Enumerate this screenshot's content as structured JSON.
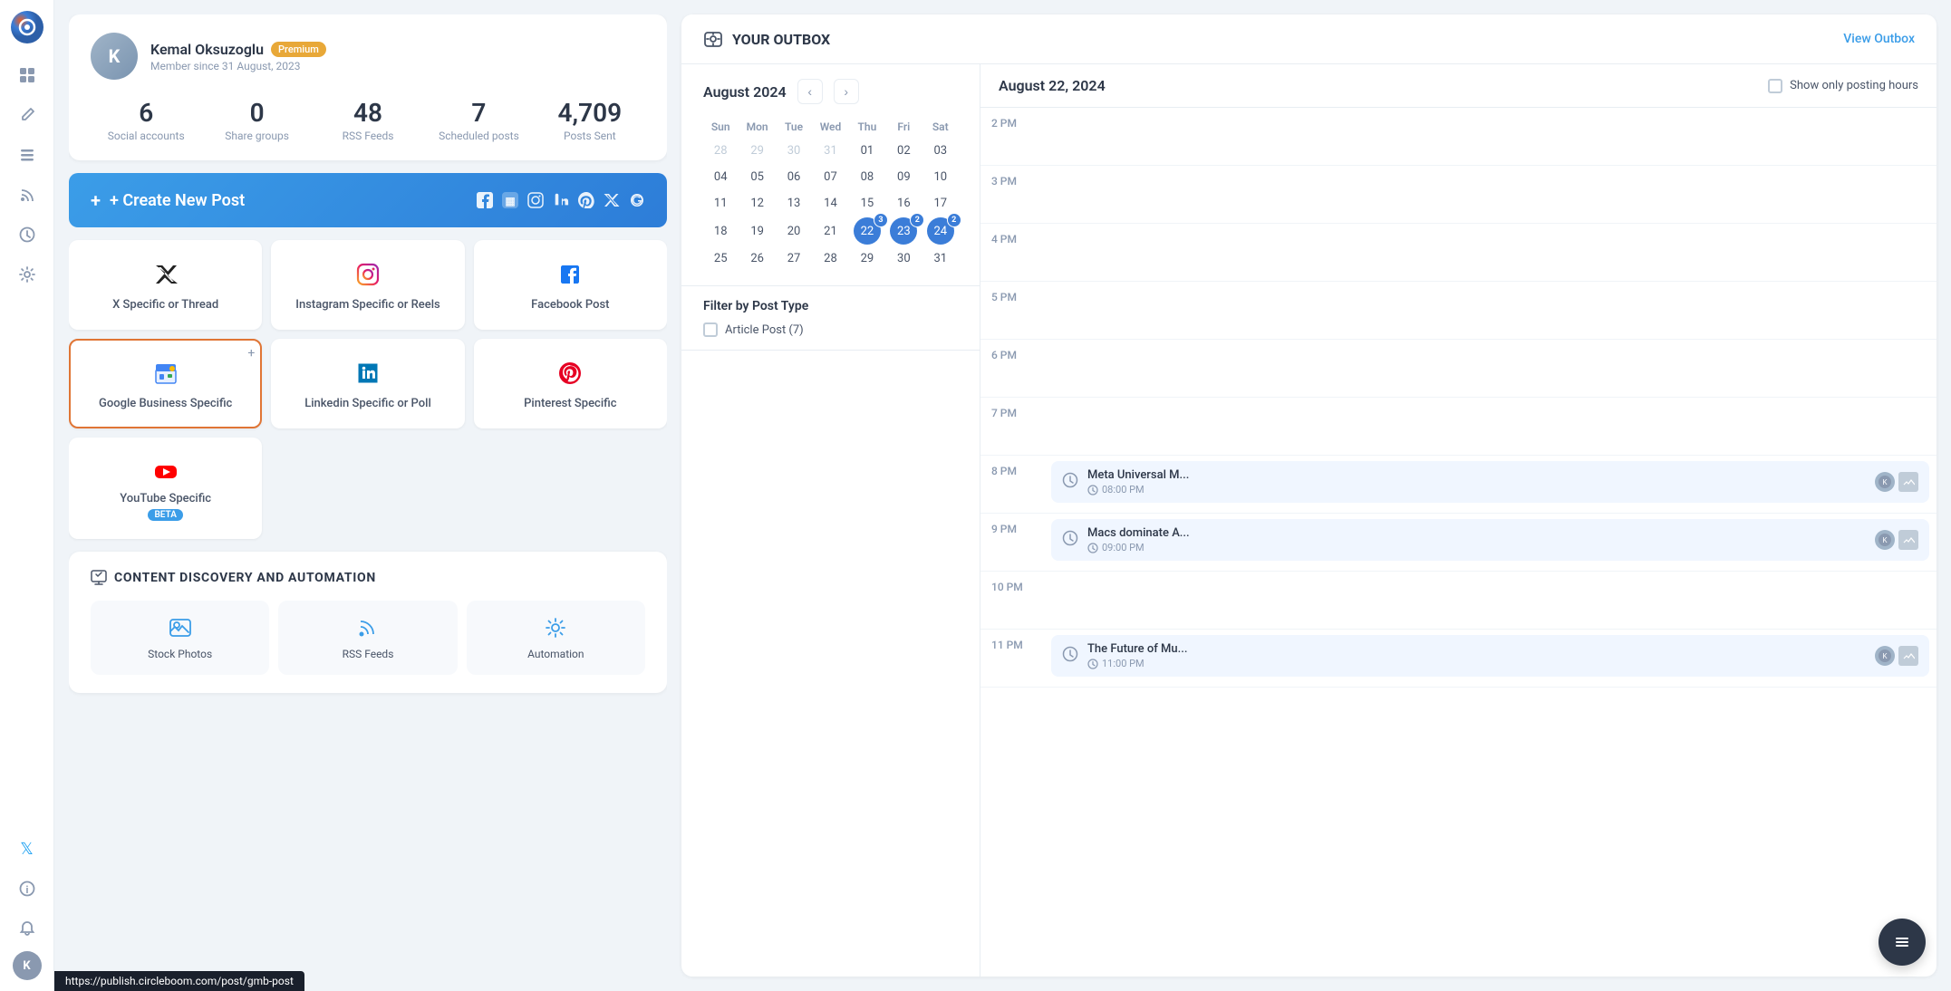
{
  "app": {
    "logo_text": "C",
    "url_bar": "https://publish.circleboom.com/post/gmb-post"
  },
  "sidebar": {
    "icons": [
      {
        "name": "grid-icon",
        "symbol": "⊞",
        "active": false
      },
      {
        "name": "edit-icon",
        "symbol": "✏",
        "active": false
      },
      {
        "name": "list-icon",
        "symbol": "☰",
        "active": false
      },
      {
        "name": "rss-icon",
        "symbol": "◎",
        "active": false
      },
      {
        "name": "clock-icon",
        "symbol": "◷",
        "active": false
      },
      {
        "name": "settings-icon",
        "symbol": "⚙",
        "active": false
      }
    ],
    "bottom_icons": [
      {
        "name": "twitter-icon",
        "symbol": "𝕏"
      },
      {
        "name": "info-icon",
        "symbol": "ℹ"
      },
      {
        "name": "bell-icon",
        "symbol": "🔔"
      },
      {
        "name": "user-avatar",
        "symbol": "K"
      }
    ]
  },
  "profile": {
    "name": "Kemal Oksuzoglu",
    "badge": "Premium",
    "since": "Member since 31 August, 2023",
    "avatar_letter": "K",
    "stats": [
      {
        "number": "6",
        "label": "Social accounts"
      },
      {
        "number": "0",
        "label": "Share groups"
      },
      {
        "number": "48",
        "label": "RSS Feeds"
      },
      {
        "number": "7",
        "label": "Scheduled posts"
      },
      {
        "number": "4,709",
        "label": "Posts Sent"
      }
    ]
  },
  "create_post": {
    "label": "+ Create New Post",
    "icons": [
      "f",
      "🟦",
      "📷",
      "in",
      "𝑃",
      "✕",
      "◎"
    ]
  },
  "post_types": [
    {
      "id": "x-specific",
      "label": "X Specific or Thread",
      "icon": "✕",
      "selected": false,
      "icon_type": "x"
    },
    {
      "id": "instagram-specific",
      "label": "Instagram Specific or Reels",
      "icon": "📷",
      "selected": false,
      "icon_type": "instagram"
    },
    {
      "id": "facebook-post",
      "label": "Facebook Post",
      "icon": "f",
      "selected": false,
      "icon_type": "facebook"
    },
    {
      "id": "google-business",
      "label": "Google Business Specific",
      "icon": "🏪",
      "selected": true,
      "icon_type": "google"
    },
    {
      "id": "linkedin-specific",
      "label": "Linkedin Specific or Poll",
      "icon": "in",
      "selected": false,
      "icon_type": "linkedin"
    },
    {
      "id": "pinterest-specific",
      "label": "Pinterest Specific",
      "icon": "𝑃",
      "selected": false,
      "icon_type": "pinterest"
    },
    {
      "id": "youtube-specific",
      "label": "YouTube Specific",
      "badge": "BETA",
      "icon": "▶",
      "selected": false,
      "icon_type": "youtube"
    }
  ],
  "content_discovery": {
    "title": "CONTENT DISCOVERY AND AUTOMATION",
    "items": [
      {
        "icon": "🖼",
        "label": "Stock Photos"
      },
      {
        "icon": "◎",
        "label": "RSS Feeds"
      },
      {
        "icon": "⚙",
        "label": "Automation"
      }
    ]
  },
  "outbox": {
    "title": "YOUR OUTBOX",
    "view_link": "View Outbox",
    "calendar_month": "August 2024",
    "date_heading": "August 22, 2024",
    "show_posting_hours_label": "Show only posting hours",
    "week_days": [
      "Sun",
      "Mon",
      "Tue",
      "Wed",
      "Thu",
      "Fri",
      "Sat"
    ],
    "calendar_rows": [
      [
        "28",
        "29",
        "30",
        "31",
        "01",
        "02",
        "03"
      ],
      [
        "04",
        "05",
        "06",
        "07",
        "08",
        "09",
        "10"
      ],
      [
        "11",
        "12",
        "13",
        "14",
        "15",
        "16",
        "17"
      ],
      [
        "18",
        "19",
        "20",
        "21",
        "22",
        "23",
        "24"
      ],
      [
        "25",
        "26",
        "27",
        "28",
        "29",
        "30",
        "31"
      ]
    ],
    "highlighted_days": [
      {
        "day": "22",
        "count": 3
      },
      {
        "day": "23",
        "count": 2
      },
      {
        "day": "24",
        "count": 2
      }
    ],
    "other_month_days": [
      "28",
      "29",
      "30",
      "31"
    ],
    "filter_title": "Filter by Post Type",
    "filter_items": [
      {
        "label": "Article Post (7)",
        "checked": false
      }
    ],
    "timeline": [
      {
        "time": "2 PM",
        "posts": []
      },
      {
        "time": "3 PM",
        "posts": []
      },
      {
        "time": "4 PM",
        "posts": []
      },
      {
        "time": "5 PM",
        "posts": []
      },
      {
        "time": "6 PM",
        "posts": []
      },
      {
        "time": "7 PM",
        "posts": []
      },
      {
        "time": "8 PM",
        "posts": [
          {
            "title": "Meta Universal M...",
            "time": "08:00 PM"
          }
        ]
      },
      {
        "time": "9 PM",
        "posts": [
          {
            "title": "Macs dominate A...",
            "time": "09:00 PM"
          }
        ]
      },
      {
        "time": "10 PM",
        "posts": []
      },
      {
        "time": "11 PM",
        "posts": [
          {
            "title": "The Future of Mu...",
            "time": "11:00 PM"
          }
        ]
      }
    ]
  }
}
